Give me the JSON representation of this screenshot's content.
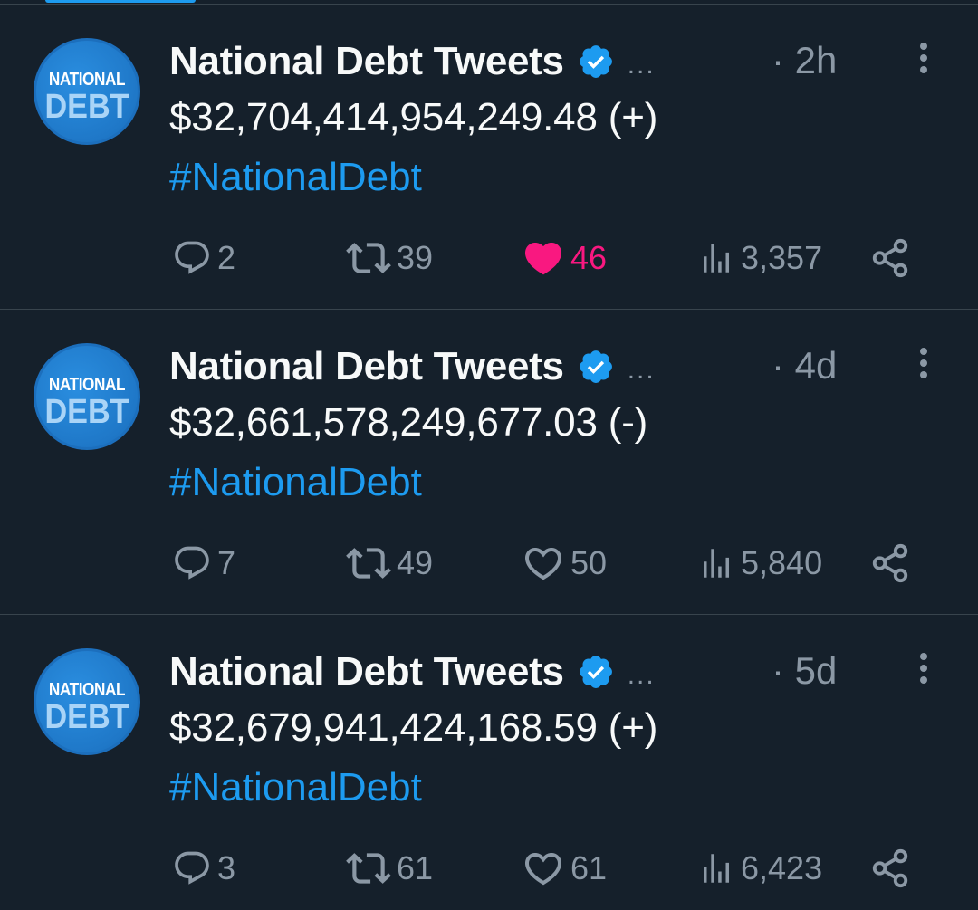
{
  "colors": {
    "background": "#15202b",
    "text_primary": "#f7f9f9",
    "text_secondary": "#8b98a5",
    "accent": "#1d9bf0",
    "like_active": "#f91880",
    "divider": "#38444d"
  },
  "tweets": [
    {
      "avatar_line1": "NATIONAL",
      "avatar_line2": "DEBT",
      "author": "National Debt Tweets",
      "ellipsis": "...",
      "time": "· 2h",
      "amount": "$32,704,414,954,249.48 (+)",
      "hashtag": "#NationalDebt",
      "replies": "2",
      "retweets": "39",
      "likes": "46",
      "liked": true,
      "views": "3,357"
    },
    {
      "avatar_line1": "NATIONAL",
      "avatar_line2": "DEBT",
      "author": "National Debt Tweets",
      "ellipsis": "...",
      "time": "· 4d",
      "amount": "$32,661,578,249,677.03 (-)",
      "hashtag": "#NationalDebt",
      "replies": "7",
      "retweets": "49",
      "likes": "50",
      "liked": false,
      "views": "5,840"
    },
    {
      "avatar_line1": "NATIONAL",
      "avatar_line2": "DEBT",
      "author": "National Debt Tweets",
      "ellipsis": "...",
      "time": "· 5d",
      "amount": "$32,679,941,424,168.59 (+)",
      "hashtag": "#NationalDebt",
      "replies": "3",
      "retweets": "61",
      "likes": "61",
      "liked": false,
      "views": "6,423"
    }
  ]
}
